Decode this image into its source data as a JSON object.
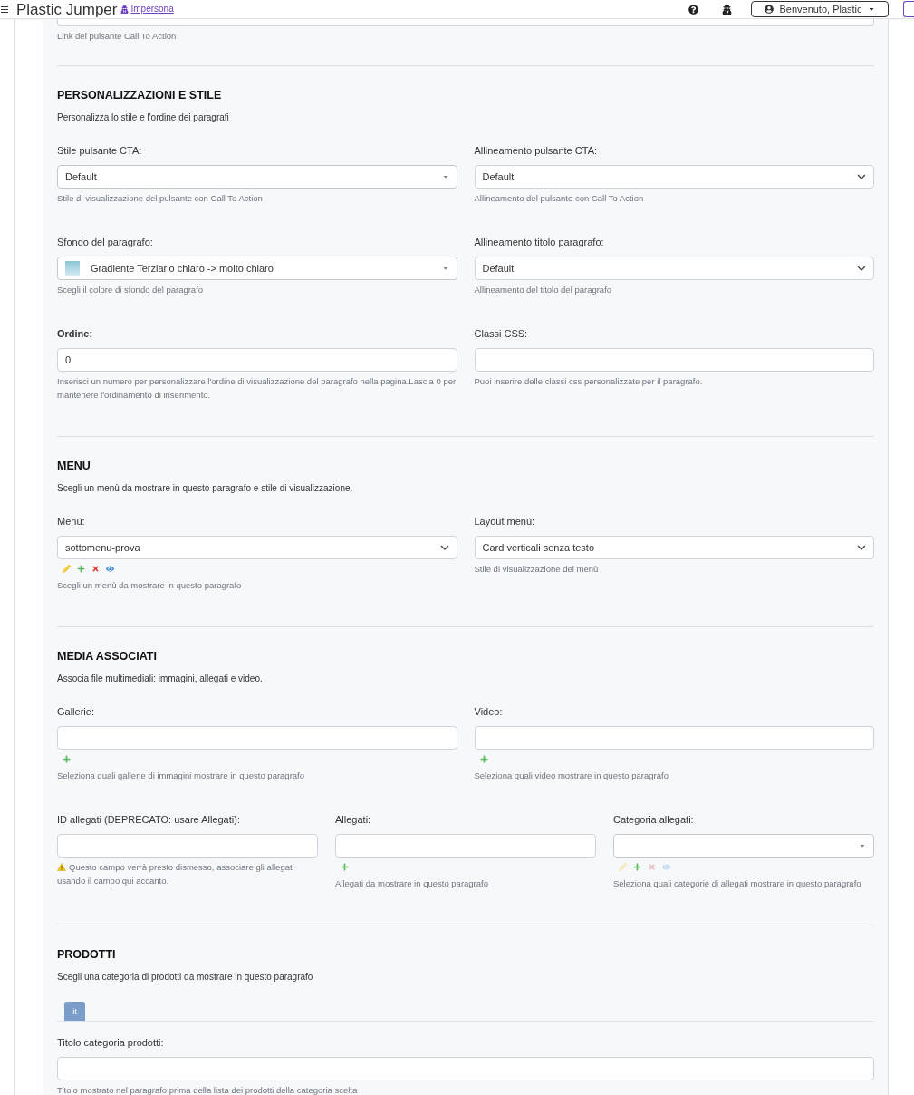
{
  "header": {
    "title": "Plastic Jumper",
    "impersona": "Impersona",
    "user_menu": "Benvenuto, Plastic"
  },
  "top_field": {
    "help": "Link del pulsante Call To Action"
  },
  "sections": [
    {
      "title": "PERSONALIZZAZIONI E STILE",
      "subtitle": "Personalizza lo stile e l'ordine dei paragrafi",
      "rows": [
        {
          "fields": [
            {
              "kind": "select2",
              "label": "Stile pulsante CTA:",
              "required": false,
              "value": "Default",
              "help": "Stile di visualizzazione del pulsante con Call To Action",
              "warning": false
            },
            {
              "kind": "select",
              "label": "Allineamento pulsante CTA:",
              "required": false,
              "value": "Default",
              "help": "Allineamento del pulsante con Call To Action",
              "warning": false
            }
          ]
        },
        {
          "fields": [
            {
              "kind": "swatch-select2",
              "label": "Sfondo del paragrafo:",
              "required": false,
              "value": "Gradiente Terziario chiaro -> molto chiaro",
              "help": "Scegli il colore di sfondo del paragrafo",
              "warning": false
            },
            {
              "kind": "select",
              "label": "Allineamento titolo paragrafo:",
              "required": false,
              "value": "Default",
              "help": "Allineamento del titolo del paragrafo",
              "warning": false
            }
          ]
        },
        {
          "fields": [
            {
              "kind": "input",
              "label": "Ordine:",
              "required": true,
              "value": "0",
              "help": "Inserisci un numero per personalizzare l'ordine di visualizzazione del paragrafo nella pagina.Lascia 0 per mantenere l'ordinamento di inserimento.",
              "warning": false
            },
            {
              "kind": "input",
              "label": "Classi CSS:",
              "required": false,
              "help": "Puoi inserire delle classi css personalizzate per il paragrafo.",
              "warning": false
            }
          ]
        }
      ]
    },
    {
      "title": "MENU",
      "subtitle": "Scegli un menù da mostrare in questo paragrafo e stile di visualizzazione.",
      "rows": [
        {
          "fields": [
            {
              "kind": "select",
              "label": "Menù:",
              "required": false,
              "value": "sottomenu-prova",
              "actions": [
                {
                  "kind": "edit",
                  "disabled": false
                },
                {
                  "kind": "add",
                  "disabled": false
                },
                {
                  "kind": "delete",
                  "disabled": false
                },
                {
                  "kind": "view",
                  "disabled": false
                }
              ],
              "help": "Scegli un menù da mostrare in questo paragrafo",
              "warning": false
            },
            {
              "kind": "select",
              "label": "Layout menù:",
              "required": false,
              "value": "Card verticali senza testo",
              "help": "Stile di visualizzazione del menù",
              "warning": false
            }
          ]
        }
      ]
    },
    {
      "title": "MEDIA ASSOCIATI",
      "subtitle": "Associa file multimediali: immagini, allegati e video.",
      "rows": [
        {
          "fields": [
            {
              "kind": "input",
              "label": "Gallerie:",
              "required": false,
              "actions": [
                {
                  "kind": "add",
                  "disabled": false
                }
              ],
              "help": "Seleziona quali gallerie di immagini mostrare in questo paragrafo",
              "warning": false
            },
            {
              "kind": "input",
              "label": "Video:",
              "required": false,
              "actions": [
                {
                  "kind": "add",
                  "disabled": false
                }
              ],
              "help": "Seleziona quali video mostrare in questo paragrafo",
              "warning": false
            }
          ]
        },
        {
          "fields": [
            {
              "kind": "input",
              "label": "ID allegati (DEPRECATO: usare Allegati):",
              "required": false,
              "help": "Questo campo verrà presto dismesso, associare gli allegati usando il campo qui accanto.",
              "warning": true
            },
            {
              "kind": "input",
              "label": "Allegati:",
              "required": false,
              "actions": [
                {
                  "kind": "add",
                  "disabled": false
                }
              ],
              "help": "Allegati da mostrare in questo paragrafo",
              "warning": false
            },
            {
              "kind": "select2",
              "label": "Categoria allegati:",
              "required": false,
              "actions": [
                {
                  "kind": "edit",
                  "disabled": true
                },
                {
                  "kind": "add",
                  "disabled": false
                },
                {
                  "kind": "delete",
                  "disabled": true
                },
                {
                  "kind": "view",
                  "disabled": true
                }
              ],
              "help": "Seleziona quali categorie di allegati mostrare in questo paragrafo",
              "warning": false
            }
          ]
        }
      ]
    },
    {
      "title": "PRODOTTI",
      "subtitle": "Scegli una categoria di prodotti da mostrare in questo paragrafo",
      "tabs": [
        {
          "label": "it",
          "selected": true
        }
      ],
      "rows": [
        {
          "fields": [
            {
              "kind": "input",
              "label": "Titolo categoria prodotti:",
              "required": false,
              "help": "Titolo mostrato nel paragrafo prima della lista dei prodotti della categoria scelta",
              "warning": false
            }
          ]
        }
      ]
    }
  ]
}
